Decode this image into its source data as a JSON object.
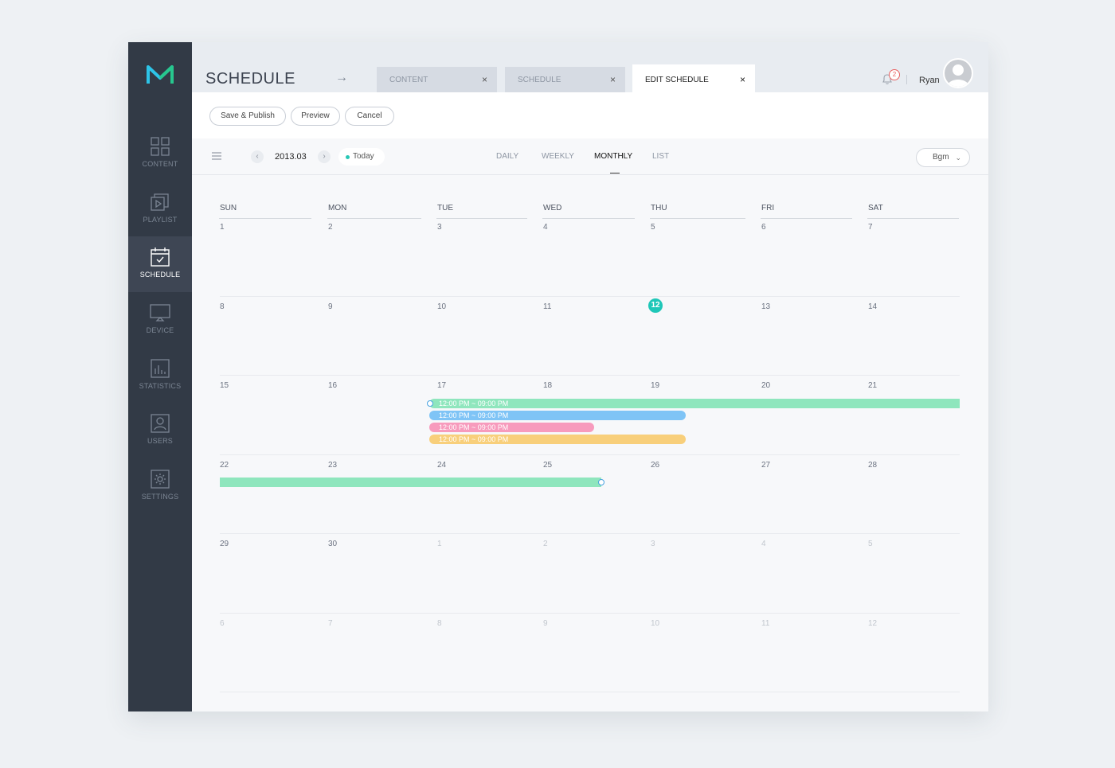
{
  "sidebar": {
    "logo_icon": "m-logo-icon",
    "items": [
      {
        "label": "CONTENT",
        "icon": "grid-icon",
        "active": false
      },
      {
        "label": "PLAYLIST",
        "icon": "playlist-icon",
        "active": false
      },
      {
        "label": "SCHEDULE",
        "icon": "calendar-icon",
        "active": true
      },
      {
        "label": "DEVICE",
        "icon": "monitor-icon",
        "active": false
      },
      {
        "label": "STATISTICS",
        "icon": "chart-icon",
        "active": false
      },
      {
        "label": "USERS",
        "icon": "user-icon",
        "active": false
      },
      {
        "label": "SETTINGS",
        "icon": "gear-icon",
        "active": false
      }
    ]
  },
  "header": {
    "title": "SCHEDULE",
    "tabs": [
      {
        "label": "CONTENT",
        "active": false
      },
      {
        "label": "SCHEDULE",
        "active": false
      },
      {
        "label": "EDIT SCHEDULE",
        "active": true
      }
    ],
    "notification_count": "2",
    "user_name": "Ryan"
  },
  "actions": {
    "save_publish": "Save & Publish",
    "preview": "Preview",
    "cancel": "Cancel"
  },
  "toolbar": {
    "month": "2013.03",
    "prev": "‹",
    "next": "›",
    "today": "Today",
    "views": [
      "DAILY",
      "WEEKLY",
      "MONTHLY",
      "LIST"
    ],
    "active_view": "MONTHLY",
    "filter_value": "Bgm"
  },
  "calendar": {
    "weekdays": [
      "SUN",
      "MON",
      "TUE",
      "WED",
      "THU",
      "FRI",
      "SAT"
    ],
    "weeks": [
      [
        "1",
        "2",
        "3",
        "4",
        "5",
        "6",
        "7"
      ],
      [
        "8",
        "9",
        "10",
        "11",
        "12",
        "13",
        "14"
      ],
      [
        "15",
        "16",
        "17",
        "18",
        "19",
        "20",
        "21"
      ],
      [
        "22",
        "23",
        "24",
        "25",
        "26",
        "27",
        "28"
      ],
      [
        "29",
        "30",
        "1",
        "2",
        "3",
        "4",
        "5"
      ],
      [
        "6",
        "7",
        "8",
        "9",
        "10",
        "11",
        "12"
      ]
    ],
    "today_date": "12",
    "more_indicator": "•••",
    "events": [
      {
        "label": "12:00 PM ~ 09:00 PM",
        "color": "#8fe6bd"
      },
      {
        "label": "12:00 PM ~ 09:00 PM",
        "color": "#7fc4f6"
      },
      {
        "label": "12:00 PM ~ 09:00 PM",
        "color": "#f79bbd"
      },
      {
        "label": "12:00 PM ~ 09:00 PM",
        "color": "#f8cf7b"
      }
    ]
  },
  "colors": {
    "accent": "#1fc7b8",
    "sidebar_bg": "#323a46"
  }
}
